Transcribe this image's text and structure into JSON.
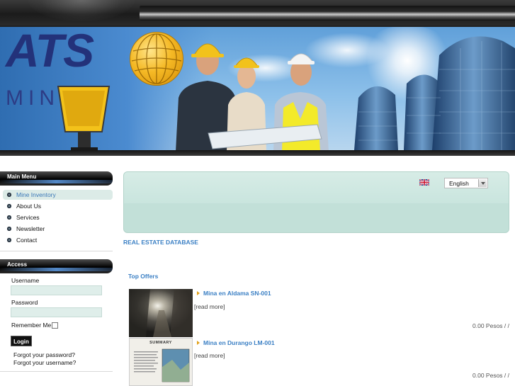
{
  "brand": {
    "logo_top": "ATS",
    "logo_bottom": "MINING"
  },
  "main_menu": {
    "title": "Main Menu",
    "items": [
      {
        "label": "Mine Inventory",
        "active": true
      },
      {
        "label": "About Us",
        "active": false
      },
      {
        "label": "Services",
        "active": false
      },
      {
        "label": "Newsletter",
        "active": false
      },
      {
        "label": "Contact",
        "active": false
      }
    ]
  },
  "access": {
    "title": "Access",
    "username_label": "Username",
    "username_value": "",
    "password_label": "Password",
    "password_value": "",
    "remember_label": "Remember Me",
    "remember_checked": false,
    "login_label": "Login",
    "forgot_password": "Forgot your password?",
    "forgot_username": "Forgot your username?"
  },
  "language": {
    "flag_icon": "uk-flag-icon",
    "selected": "English"
  },
  "main": {
    "heading": "REAL ESTATE DATABASE",
    "top_offers_title": "Top Offers",
    "offers": [
      {
        "title": "Mina en Aldama SN-001",
        "read_more": "[read more]",
        "price": "0.00 Pesos / /"
      },
      {
        "title": "Mina en Durango LM-001",
        "read_more": "[read more]",
        "price": "0.00 Pesos / /",
        "thumb_caption": "Summary"
      }
    ]
  },
  "colors": {
    "accent_blue": "#3a7fc4",
    "panel_green": "#c2e0d8",
    "active_menu_bg": "#dcebe7",
    "logo_navy": "#23327a",
    "bullet_orange": "#e2a21a"
  }
}
